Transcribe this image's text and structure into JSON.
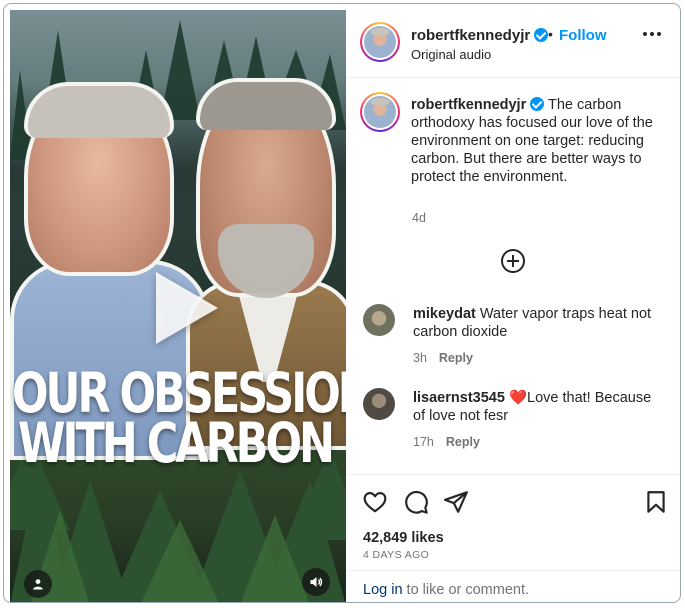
{
  "media": {
    "headline_line1": "OUR OBSESSION",
    "headline_line2": "WITH CARBON",
    "icons": [
      "play-icon",
      "user-tag-icon",
      "volume-icon"
    ]
  },
  "header": {
    "username": "robertfkennedyjr",
    "separator": "•",
    "follow_label": "Follow",
    "audio_label": "Original audio",
    "verified": true
  },
  "caption": {
    "username": "robertfkennedyjr",
    "text": "The carbon orthodoxy has focused our love of the environment on one target: reducing carbon. But there are better ways to protect the environment.",
    "time": "4d"
  },
  "comments": [
    {
      "username": "mikeydat",
      "text": "Water vapor traps heat not carbon dioxide",
      "time": "3h",
      "reply_label": "Reply"
    },
    {
      "username": "lisaernst3545",
      "emoji": "❤️",
      "text": "Love that! Because of love not fesr",
      "time": "17h",
      "reply_label": "Reply"
    }
  ],
  "stats": {
    "likes": "42,849 likes",
    "date": "4 DAYS AGO"
  },
  "footer": {
    "login_link": "Log in",
    "login_rest": " to like or comment."
  },
  "colors": {
    "link_blue": "#0095f6",
    "verified_blue": "#0095f6",
    "heart_red": "#ed1c3a",
    "muted_text": "#737373"
  }
}
